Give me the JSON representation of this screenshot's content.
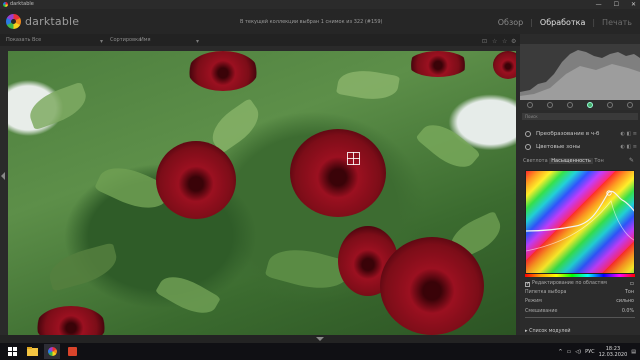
{
  "window": {
    "title": "darktable",
    "min": "—",
    "max": "☐",
    "close": "✕"
  },
  "header": {
    "app_name": "darktable",
    "info": "В текущей коллекции выбран 1 снимок из 322 (#159)",
    "modes": [
      "Обзор",
      "Обработка",
      "Печать"
    ],
    "active_mode": "Обработка"
  },
  "filterbar": {
    "filter_label": "Показать",
    "filter_value": "Все",
    "sort_label": "Сортировка",
    "sort_value": "Имя"
  },
  "right_panel": {
    "search_placeholder": "Поиск",
    "modules": [
      {
        "name": "Преобразование в ч-б"
      },
      {
        "name": "Цветовые зоны"
      }
    ],
    "colorzones": {
      "tabs": [
        "Светлота",
        "Насыщенность",
        "Тон"
      ],
      "active_tab": "Насыщенность",
      "edit_by_area_label": "Редактирование по областям",
      "pick_label": "Пипетка выбора",
      "pick_value": "Тон",
      "mode_label": "Режим",
      "mode_value": "сильно",
      "mix_label": "Смешивание",
      "mix_value": "0.0%",
      "mix_fraction": 0.0
    },
    "module_list_label": "Список модулей"
  },
  "taskbar": {
    "lang": "РУС",
    "time": "18:23",
    "date": "12.03.2020"
  },
  "colors": {
    "accent": "#e2e2e2",
    "panel": "#2b2b2b",
    "taskbar": "#101014"
  }
}
